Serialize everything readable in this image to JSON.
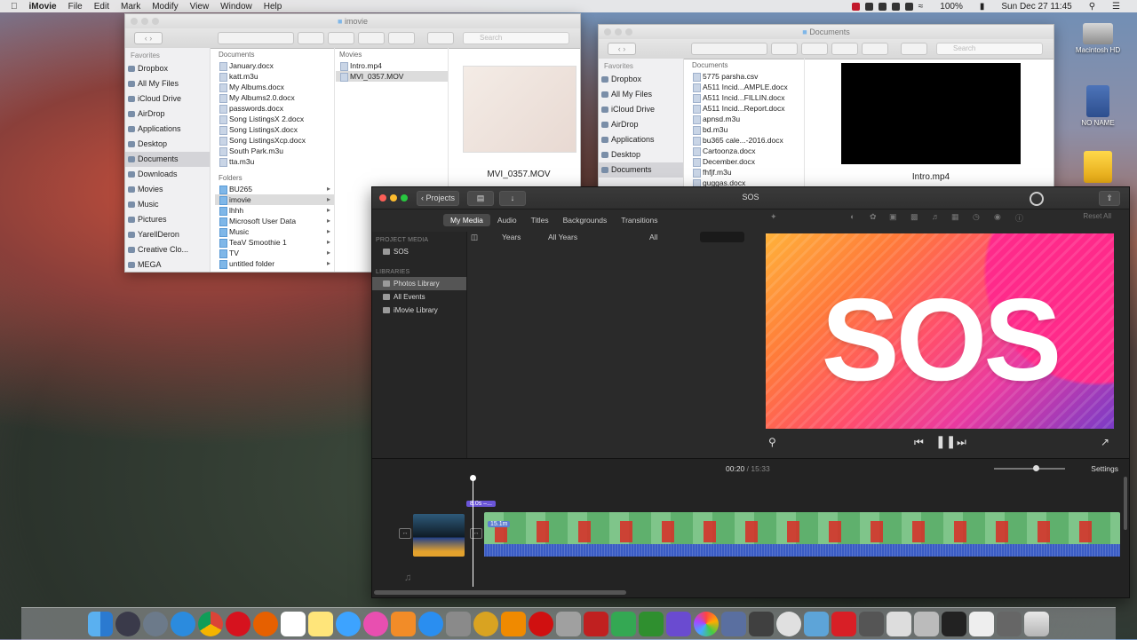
{
  "menubar": {
    "app": "iMovie",
    "items": [
      "File",
      "Edit",
      "Mark",
      "Modify",
      "View",
      "Window",
      "Help"
    ],
    "battery": "100%",
    "clock": "Sun Dec 27  11:45"
  },
  "finder1": {
    "title": "imovie",
    "search_placeholder": "Search",
    "sidebar_header": "Favorites",
    "sidebar": [
      "Dropbox",
      "All My Files",
      "iCloud Drive",
      "AirDrop",
      "Applications",
      "Desktop",
      "Documents",
      "Downloads",
      "Movies",
      "Music",
      "Pictures",
      "YarellDeron",
      "Creative Clo...",
      "MEGA"
    ],
    "col1_header": "Documents",
    "col1_files": [
      "January.docx",
      "katt.m3u",
      "My Albums.docx",
      "My Albums2.0.docx",
      "passwords.docx",
      "Song ListingsX 2.docx",
      "Song ListingsX.docx",
      "Song ListingsXcp.docx",
      "South Park.m3u",
      "tta.m3u"
    ],
    "col1_folders_header": "Folders",
    "col1_folders": [
      "BU265",
      "imovie",
      "lhhh",
      "Microsoft User Data",
      "Music",
      "TeaV Smoothie 1",
      "TV",
      "untitled folder"
    ],
    "col2_header": "Movies",
    "col2_files": [
      "Intro.mp4",
      "MVI_0357.MOV"
    ],
    "preview_name": "MVI_0357.MOV"
  },
  "finder2": {
    "title": "Documents",
    "search_placeholder": "Search",
    "sidebar_header": "Favorites",
    "sidebar": [
      "Dropbox",
      "All My Files",
      "iCloud Drive",
      "AirDrop",
      "Applications",
      "Desktop",
      "Documents"
    ],
    "col1_header": "Documents",
    "col1_files": [
      "5775 parsha.csv",
      "A511 Incid...AMPLE.docx",
      "A511 Incid...FILLIN.docx",
      "A511 Incid...Report.docx",
      "apnsd.m3u",
      "bd.m3u",
      "bu365 cale...-2016.docx",
      "Cartoonza.docx",
      "December.docx",
      "fhfjf.m3u",
      "guggas.docx"
    ],
    "preview_name": "Intro.mp4"
  },
  "imovie": {
    "title": "SOS",
    "projects_button": "Projects",
    "tabs": [
      "My Media",
      "Audio",
      "Titles",
      "Backgrounds",
      "Transitions"
    ],
    "reset_all": "Reset All",
    "project_media_header": "PROJECT MEDIA",
    "project_item": "SOS",
    "libraries_header": "LIBRARIES",
    "libraries": [
      "Photos Library",
      "All Events",
      "iMovie Library"
    ],
    "filter_years": "Years",
    "filter_all_years": "All Years",
    "filter_all": "All",
    "viewer_text": "SOS",
    "time_current": "00:20",
    "time_sep": "/",
    "time_total": "15:33",
    "settings": "Settings",
    "clip_tag": "8.0s –...",
    "clip_label": "15.1m"
  },
  "desktop": {
    "icons": [
      "Macintosh HD",
      "NO NAME"
    ]
  },
  "colors": {
    "accent": "#5a8fe0",
    "imovie_bg": "#2a2a2a",
    "viewer_pink": "#e93aa0",
    "viewer_orange": "#ffb23a"
  }
}
